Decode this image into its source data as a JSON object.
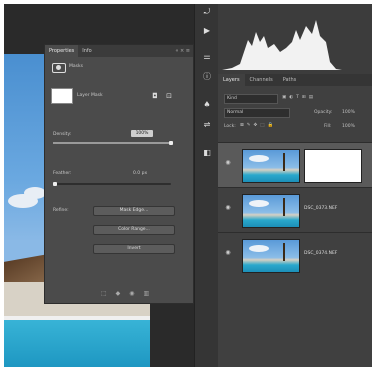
{
  "properties_panel": {
    "tabs": [
      "Properties",
      "Info"
    ],
    "panel_controls": "« ×  ≡",
    "section_title": "Masks",
    "layer_mask_label": "Layer Mask",
    "density_label": "Density:",
    "density_value": "100%",
    "density_level": 1.0,
    "feather_label": "Feather:",
    "feather_value": "0.0 px",
    "feather_level": 0.0,
    "refine_label": "Refine:",
    "buttons": [
      "Mask Edge...",
      "Color Range...",
      "Invert"
    ]
  },
  "layers_panel": {
    "tabs": [
      "Layers",
      "Channels",
      "Paths"
    ],
    "filter_kind": "Kind",
    "blend_mode": "Normal",
    "opacity_label": "Opacity:",
    "opacity_value": "100%",
    "lock_label": "Lock:",
    "fill_label": "Fill:",
    "fill_value": "100%",
    "layers": [
      {
        "name": "",
        "has_mask": true,
        "selected": true
      },
      {
        "name": "DSC_0373.NEF",
        "has_mask": false,
        "selected": false
      },
      {
        "name": "DSC_0374.NEF",
        "has_mask": false,
        "selected": false
      }
    ]
  },
  "icons": [
    "mask-icon",
    "visibility-eye-icon",
    "play-icon",
    "history-icon",
    "info-icon",
    "brush-icon",
    "adjust-icon",
    "trash-icon",
    "link-icon"
  ]
}
